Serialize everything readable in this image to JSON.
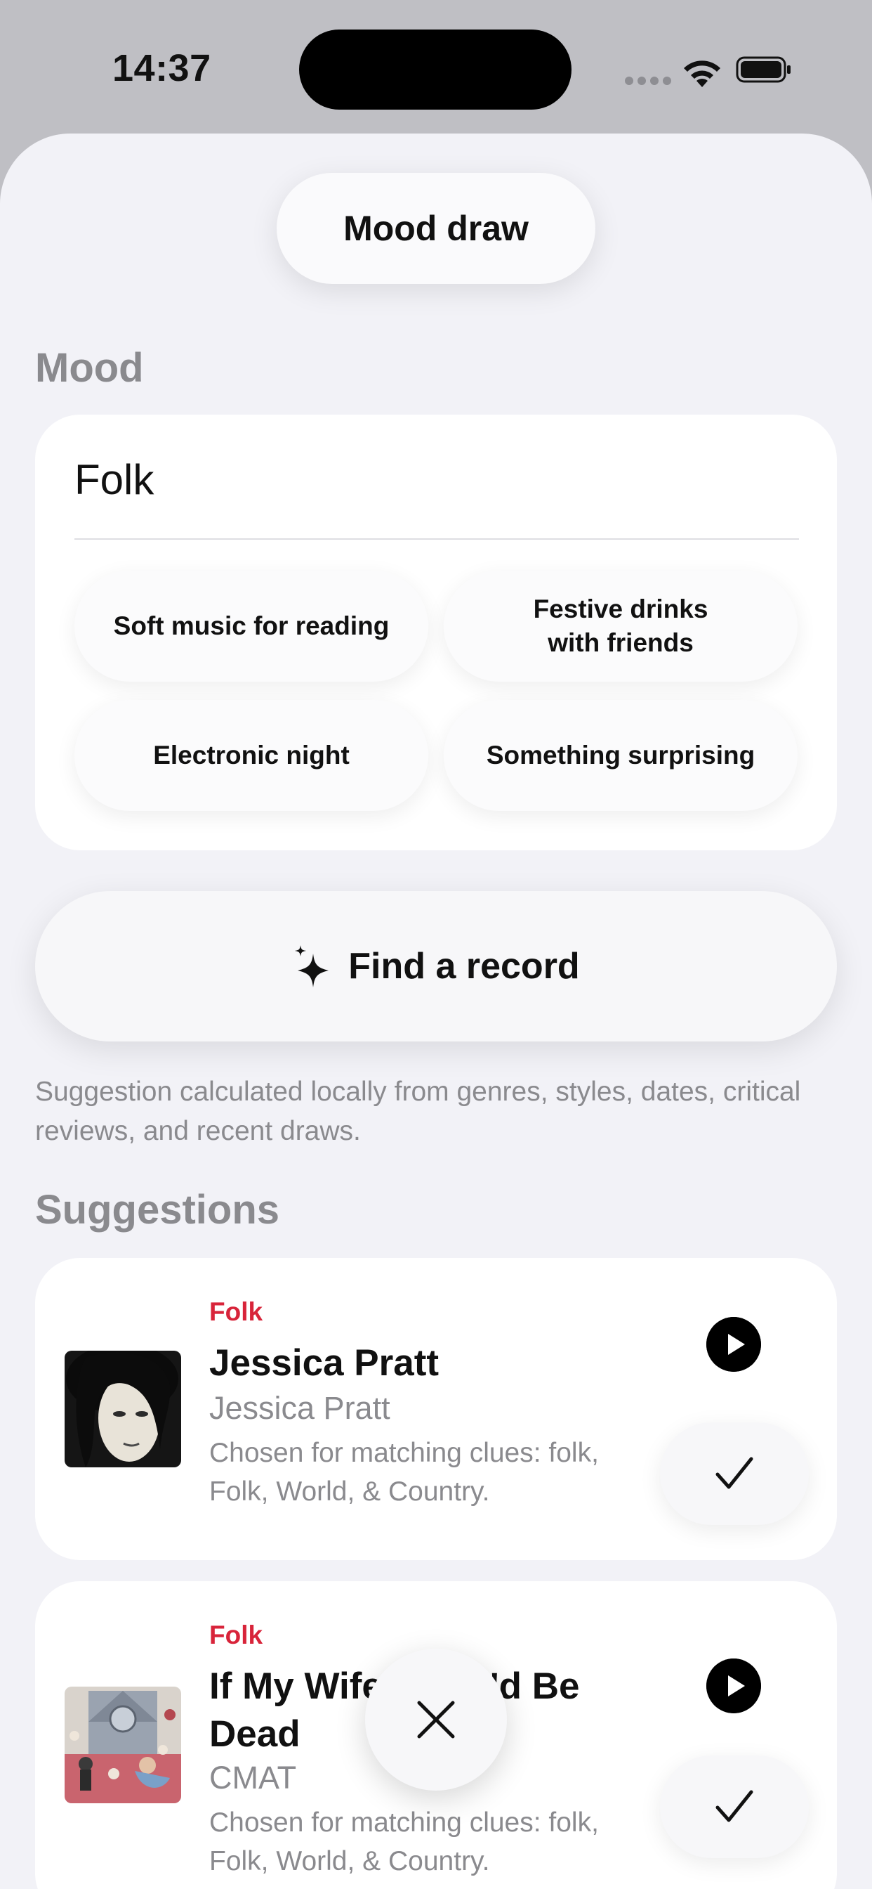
{
  "status_bar": {
    "time": "14:37"
  },
  "header": {
    "title": "Mood draw"
  },
  "mood": {
    "section_title": "Mood",
    "value": "Folk",
    "chips": [
      "Soft music for reading",
      "Festive drinks\nwith friends",
      "Electronic night",
      "Something surprising"
    ]
  },
  "find_button": {
    "label": "Find a record",
    "icon": "sparkle-icon"
  },
  "note": "Suggestion calculated locally from genres, styles, dates, critical reviews, and recent draws.",
  "suggestions": {
    "section_title": "Suggestions",
    "items": [
      {
        "genre": "Folk",
        "title": "Jessica Pratt",
        "artist": "Jessica Pratt",
        "reason": "Chosen for matching clues: folk, Folk, World, & Country."
      },
      {
        "genre": "Folk",
        "title": "If My Wife New I'd Be Dead",
        "artist": "CMAT",
        "reason": "Chosen for matching clues: folk, Folk, World, & Country."
      }
    ]
  },
  "colors": {
    "accent_red": "#d8243a",
    "secondary_text": "#8a8a8e",
    "background": "#f2f2f7"
  }
}
